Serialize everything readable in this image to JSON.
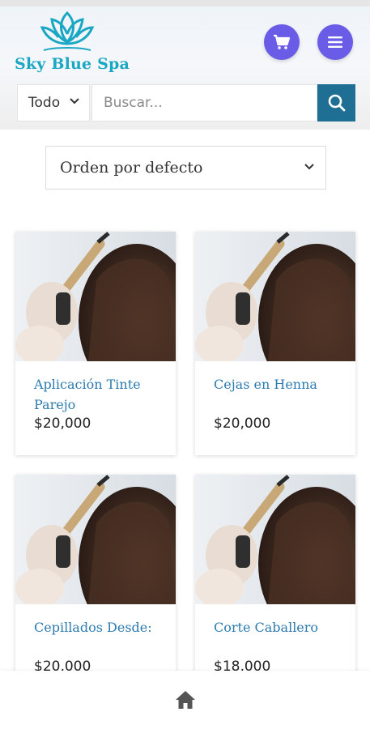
{
  "brand": {
    "name": "Sky Blue Spa",
    "logo_icon": "lotus-icon",
    "colors": {
      "logo": "#1aa7c4",
      "accent": "#6a5ce6",
      "search_button": "#1f6e93",
      "link": "#2d7bb0"
    }
  },
  "header": {
    "cart_icon": "cart-icon",
    "menu_icon": "hamburger-icon"
  },
  "search": {
    "category_label": "Todo",
    "placeholder": "Buscar...",
    "button_icon": "search-icon"
  },
  "sort": {
    "selected": "Orden por defecto"
  },
  "products": [
    {
      "title": "Aplicación Tinte Parejo",
      "price": "$20,000"
    },
    {
      "title": "Cejas en Henna",
      "price": "$20,000"
    },
    {
      "title": "Cepillados Desde:",
      "price": "$20,000"
    },
    {
      "title": "Corte Caballero",
      "price": "$18,000"
    }
  ],
  "bottom_nav": {
    "home_icon": "home-icon"
  }
}
